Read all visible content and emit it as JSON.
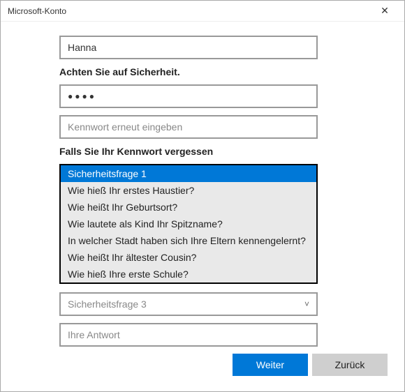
{
  "window": {
    "title": "Microsoft-Konto"
  },
  "fields": {
    "name_value": "Hanna",
    "security_heading": "Achten Sie auf Sicherheit.",
    "password_mask": "●●●●",
    "password_confirm_placeholder": "Kennwort erneut eingeben",
    "forgot_heading": "Falls Sie Ihr Kennwort vergessen"
  },
  "dropdown1": {
    "options": [
      "Sicherheitsfrage 1",
      "Wie hieß Ihr erstes Haustier?",
      "Wie heißt Ihr Geburtsort?",
      "Wie lautete als Kind Ihr Spitzname?",
      "In welcher Stadt haben sich Ihre Eltern kennengelernt?",
      "Wie heißt Ihr ältester Cousin?",
      "Wie hieß Ihre erste Schule?"
    ]
  },
  "dropdown3": {
    "placeholder": "Sicherheitsfrage 3"
  },
  "answer": {
    "placeholder": "Ihre Antwort"
  },
  "buttons": {
    "next": "Weiter",
    "back": "Zurück"
  }
}
